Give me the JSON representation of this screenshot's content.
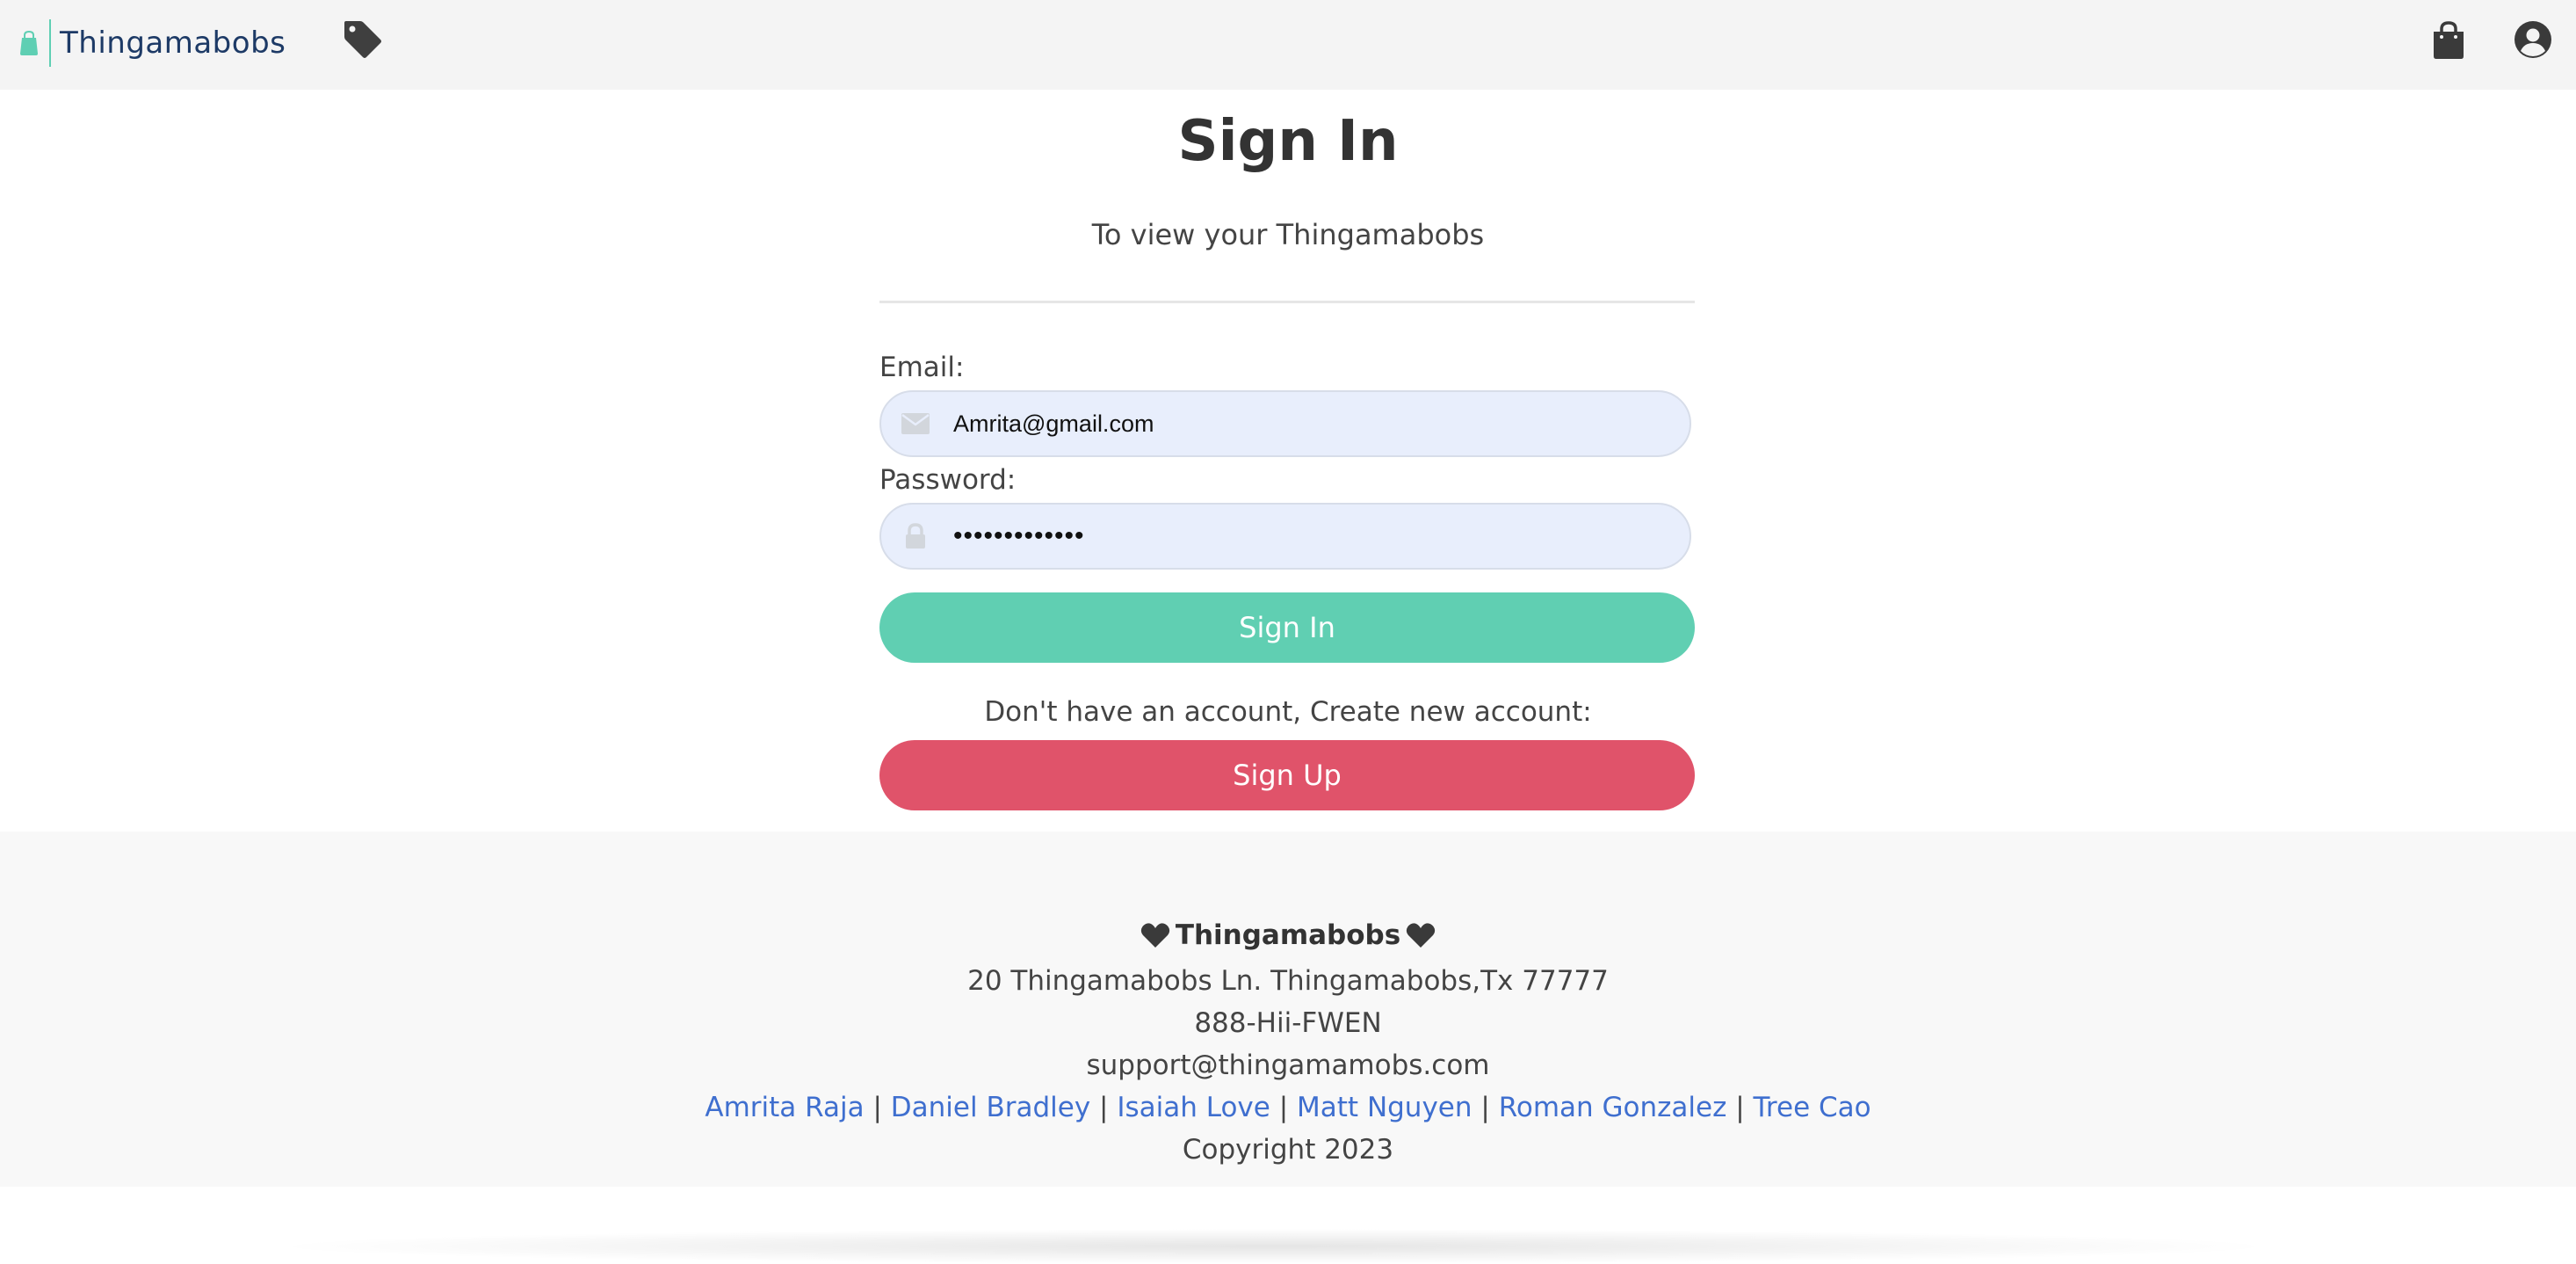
{
  "header": {
    "brand_name": "Thingamabobs",
    "icons": [
      "shopping-bag-logo-icon",
      "tag-icon",
      "shopping-bag-icon",
      "user-circle-icon"
    ]
  },
  "signin": {
    "title": "Sign In",
    "subtitle": "To view your Thingamabobs",
    "email_label": "Email:",
    "email_value": "Amrita@gmail.com",
    "password_label": "Password:",
    "password_value": "•••••••••••••",
    "signin_button": "Sign In",
    "prompt": "Don't have an account, Create new account:",
    "signup_button": "Sign Up"
  },
  "footer": {
    "brand": "Thingamabobs",
    "address": "20 Thingamabobs Ln. Thingamabobs,Tx 77777",
    "phone": "888-Hii-FWEN",
    "email": "support@thingamamobs.com",
    "team": [
      "Amrita Raja",
      "Daniel Bradley",
      "Isaiah Love",
      "Matt Nguyen",
      "Roman Gonzalez",
      "Tree Cao"
    ],
    "separator": "|",
    "copyright": "Copyright 2023"
  },
  "colors": {
    "accent_green": "#60cfb2",
    "accent_red": "#e0536a",
    "brand_blue": "#1d3a66",
    "link_blue": "#3f6fcf",
    "input_bg": "#e8eefc"
  }
}
